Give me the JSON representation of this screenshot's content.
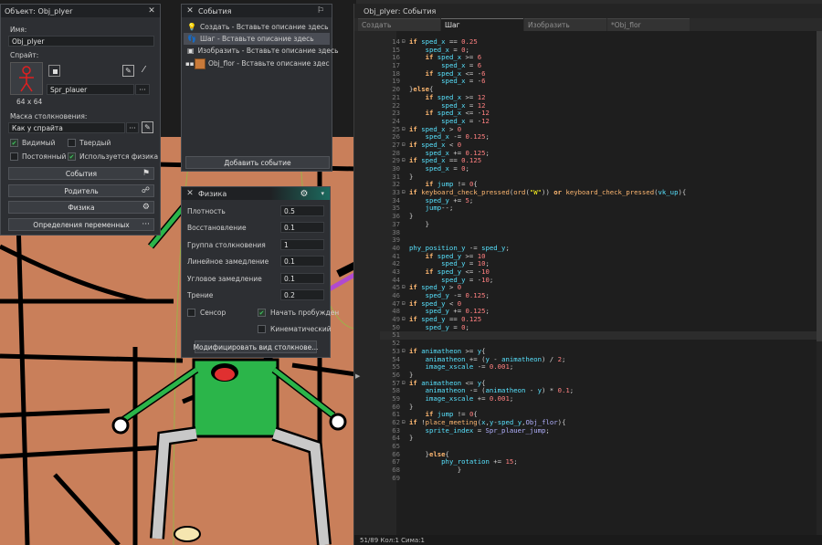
{
  "object_window": {
    "title": "Объект: Obj_plyer",
    "name_label": "Имя:",
    "name_value": "Obj_plyer",
    "sprite_label": "Спрайт:",
    "sprite_name": "Spr_plauer",
    "sprite_size": "64 x 64",
    "sprite_more": "···",
    "mask_label": "Маска столкновения:",
    "mask_value": "Как у спрайта",
    "mask_more": "···",
    "visible_label": "Видимый",
    "solid_label": "Твердый",
    "persistent_label": "Постоянный",
    "physics_label": "Используется физика",
    "visible_checked": true,
    "solid_checked": false,
    "persistent_checked": false,
    "physics_checked": true,
    "events_button": "События",
    "parent_button": "Родитель",
    "physics_button": "Физика",
    "variables_button": "Определения переменных"
  },
  "events_window": {
    "title": "События",
    "items": [
      {
        "label": "Создать - Вставьте описание здесь"
      },
      {
        "label": "Шаг - Вставьте описание здесь"
      },
      {
        "label": "Изобразить - Вставьте описание здесь"
      },
      {
        "label": "Obj_flor - Вставьте описание здес"
      }
    ],
    "selected_index": 1,
    "add_button": "Добавить событие"
  },
  "physics_window": {
    "title": "Физика",
    "fields": [
      {
        "label": "Плотность",
        "value": "0.5"
      },
      {
        "label": "Восстановление",
        "value": "0.1"
      },
      {
        "label": "Группа столкновения",
        "value": "1"
      },
      {
        "label": "Линейное замедление",
        "value": "0.1"
      },
      {
        "label": "Угловое замедление",
        "value": "0.1"
      },
      {
        "label": "Трение",
        "value": "0.2"
      }
    ],
    "sensor_label": "Сенсор",
    "awake_label": "Начать пробужден",
    "kinematic_label": "Кинематический",
    "sensor_checked": false,
    "awake_checked": true,
    "kinematic_checked": false,
    "modify_button": "Модифицировать вид столкнове..."
  },
  "editor": {
    "title": "Obj_plyer: События",
    "tabs": [
      {
        "label": "Создать",
        "active": false
      },
      {
        "label": "Шаг",
        "active": true
      },
      {
        "label": "Изобразить",
        "active": false
      },
      {
        "label": "*Obj_flor",
        "active": false
      }
    ],
    "status": "51/89 Кол:1 Сима:1",
    "current_line": 51,
    "lines": [
      {
        "n": 14,
        "fold": "⊟",
        "code": "if sped_x == 0.25"
      },
      {
        "n": 15,
        "fold": "",
        "code": "    sped_x = 0;"
      },
      {
        "n": 16,
        "fold": "",
        "code": "    if sped_x >= 6"
      },
      {
        "n": 17,
        "fold": "",
        "code": "        sped_x = 6"
      },
      {
        "n": 18,
        "fold": "",
        "code": "    if sped_x <= -6"
      },
      {
        "n": 19,
        "fold": "",
        "code": "        sped_x = -6"
      },
      {
        "n": 20,
        "fold": "",
        "code": "}else{"
      },
      {
        "n": 21,
        "fold": "",
        "code": "    if sped_x >= 12"
      },
      {
        "n": 22,
        "fold": "",
        "code": "        sped_x = 12"
      },
      {
        "n": 23,
        "fold": "",
        "code": "    if sped_x <= -12"
      },
      {
        "n": 24,
        "fold": "",
        "code": "        sped_x = -12"
      },
      {
        "n": 25,
        "fold": "⊟",
        "code": "if sped_x > 0"
      },
      {
        "n": 26,
        "fold": "",
        "code": "    sped_x -= 0.125;"
      },
      {
        "n": 27,
        "fold": "⊟",
        "code": "if sped_x < 0"
      },
      {
        "n": 28,
        "fold": "",
        "code": "    sped_x += 0.125;"
      },
      {
        "n": 29,
        "fold": "⊟",
        "code": "if sped_x == 0.125"
      },
      {
        "n": 30,
        "fold": "",
        "code": "    sped_x = 0;"
      },
      {
        "n": 31,
        "fold": "",
        "code": "}"
      },
      {
        "n": 32,
        "fold": "",
        "code": "    if jump != 0{"
      },
      {
        "n": 33,
        "fold": "⊟",
        "code": "if keyboard_check_pressed(ord(\"W\")) or keyboard_check_pressed(vk_up){"
      },
      {
        "n": 34,
        "fold": "",
        "code": "    sped_y += 5;"
      },
      {
        "n": 35,
        "fold": "",
        "code": "    jump--;"
      },
      {
        "n": 36,
        "fold": "",
        "code": "}"
      },
      {
        "n": 37,
        "fold": "",
        "code": "    }"
      },
      {
        "n": 38,
        "fold": "",
        "code": ""
      },
      {
        "n": 39,
        "fold": "",
        "code": ""
      },
      {
        "n": 40,
        "fold": "",
        "code": "phy_position_y -= sped_y;"
      },
      {
        "n": 41,
        "fold": "",
        "code": "    if sped_y >= 10"
      },
      {
        "n": 42,
        "fold": "",
        "code": "        sped_y = 10;"
      },
      {
        "n": 43,
        "fold": "",
        "code": "    if sped_y <= -10"
      },
      {
        "n": 44,
        "fold": "",
        "code": "        sped_y = -10;"
      },
      {
        "n": 45,
        "fold": "⊟",
        "code": "if sped_y > 0"
      },
      {
        "n": 46,
        "fold": "",
        "code": "    sped_y -= 0.125;"
      },
      {
        "n": 47,
        "fold": "⊟",
        "code": "if sped_y < 0"
      },
      {
        "n": 48,
        "fold": "",
        "code": "    sped_y += 0.125;"
      },
      {
        "n": 49,
        "fold": "⊟",
        "code": "if sped_y == 0.125"
      },
      {
        "n": 50,
        "fold": "",
        "code": "    sped_y = 0;"
      },
      {
        "n": 51,
        "fold": "",
        "code": ""
      },
      {
        "n": 52,
        "fold": "",
        "code": ""
      },
      {
        "n": 53,
        "fold": "⊟",
        "code": "if animatheon >= y{"
      },
      {
        "n": 54,
        "fold": "",
        "code": "    animatheon += (y - animatheon) / 2;"
      },
      {
        "n": 55,
        "fold": "",
        "code": "    image_xscale -= 0.001;"
      },
      {
        "n": 56,
        "fold": "",
        "code": "}"
      },
      {
        "n": 57,
        "fold": "⊟",
        "code": "if animatheon <= y{"
      },
      {
        "n": 58,
        "fold": "",
        "code": "    animatheon -= (animatheon - y) * 0.1;"
      },
      {
        "n": 59,
        "fold": "",
        "code": "    image_xscale += 0.001;"
      },
      {
        "n": 60,
        "fold": "",
        "code": "}"
      },
      {
        "n": 61,
        "fold": "",
        "code": "    if jump != 0{"
      },
      {
        "n": 62,
        "fold": "⊟",
        "code": "if !place_meeting(x,y-sped_y,Obj_flor){"
      },
      {
        "n": 63,
        "fold": "",
        "code": "    sprite_index = Spr_plauer_jump;"
      },
      {
        "n": 64,
        "fold": "",
        "code": "}"
      },
      {
        "n": 65,
        "fold": "",
        "code": ""
      },
      {
        "n": 66,
        "fold": "",
        "code": "    }else{"
      },
      {
        "n": 67,
        "fold": "",
        "code": "        phy_rotation += 15;"
      },
      {
        "n": 68,
        "fold": "",
        "code": "            }"
      },
      {
        "n": 69,
        "fold": "",
        "code": ""
      }
    ]
  },
  "colors": {
    "keyword": "#ffb871",
    "variable": "#58e3ff",
    "number": "#ff8080",
    "string": "#fcf320",
    "room_floor": "#c97f5a",
    "player_green": "#2bb54a"
  }
}
